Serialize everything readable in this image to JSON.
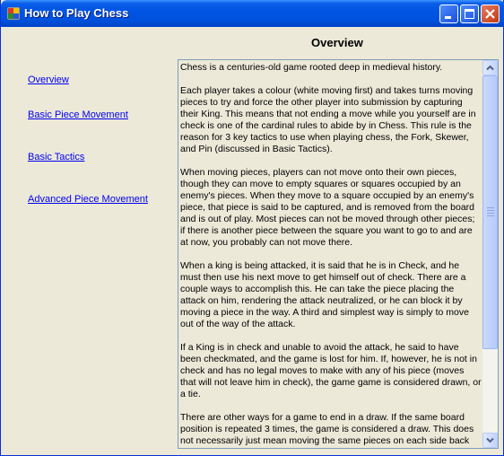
{
  "window": {
    "title": "How to Play Chess",
    "icons": [
      "app-icon",
      "minimize-icon",
      "maximize-icon",
      "close-icon"
    ]
  },
  "colors": {
    "titlebar": "#0054E3",
    "window_bg": "#ECE9D8",
    "link": "#0000EE",
    "close_button": "#C23A14"
  },
  "header": {
    "title": "Overview"
  },
  "nav": {
    "items": [
      {
        "label": "Overview"
      },
      {
        "label": "Basic Piece Movement"
      },
      {
        "label": "Basic Tactics"
      },
      {
        "label": "Advanced Piece Movement"
      }
    ]
  },
  "content": {
    "paragraphs": [
      "Chess is a centuries-old game rooted deep in medieval history.",
      "Each player takes a colour (white moving first) and takes turns moving pieces to try and force the other player into submission by capturing their King. This means that not ending a move while you yourself are in check is one of the cardinal rules to abide by in Chess. This rule is the reason for 3 key tactics to use when playing chess, the Fork, Skewer, and Pin (discussed in Basic Tactics).",
      "When moving pieces, players can not move onto their own pieces, though they can move to empty squares or squares occupied by an enemy's pieces. When they move to a square occupied by an enemy's piece, that piece is said to be captured, and is removed from the board and is out of play. Most pieces can not be moved through other pieces; if there is another piece between the square you want to go to and are at now, you probably can not move there.",
      "When a king is being attacked, it is said that he is in Check, and he must then use his next move to get himself out of check. There are a couple ways to accomplish this. He can take the piece placing the attack on him, rendering the attack neutralized, or he can block it by moving a piece in the way. A third and simplest way is simply to move out of the way of the attack.",
      "If a King is in check and unable to avoid the attack, he said to have been checkmated, and the game is lost for him. If, however, he is not in check and has no legal moves to make with any of his piece (moves that will not leave him in check), the game game is considered drawn, or a tie.",
      "There are other ways for a game to end in a draw. If the same board position is repeated 3 times, the game is considered a draw. This does not necessarily just mean moving the same pieces on each side back"
    ]
  },
  "scrollbar": {
    "position_fraction": 0.0,
    "visible_fraction": 0.72
  }
}
